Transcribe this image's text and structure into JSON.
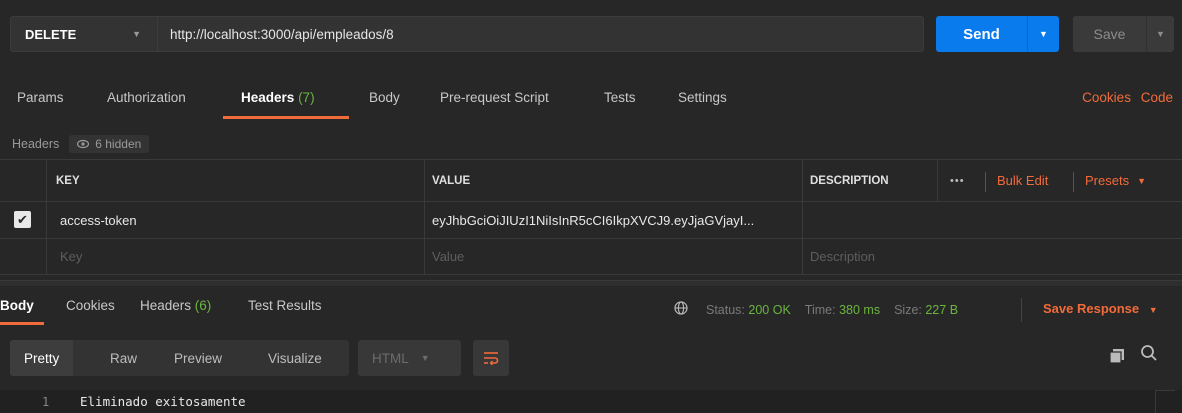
{
  "request": {
    "method": "DELETE",
    "url": "http://localhost:3000/api/empleados/8",
    "send_label": "Send",
    "save_label": "Save"
  },
  "request_tabs": {
    "params": "Params",
    "authorization": "Authorization",
    "headers": "Headers",
    "headers_count": "(7)",
    "body": "Body",
    "prerequest": "Pre-request Script",
    "tests": "Tests",
    "settings": "Settings",
    "cookies": "Cookies",
    "code": "Code"
  },
  "headers_section": {
    "label": "Headers",
    "hidden": "6 hidden"
  },
  "table": {
    "columns": {
      "key": "KEY",
      "value": "VALUE",
      "description": "DESCRIPTION"
    },
    "more": "•••",
    "bulk_edit": "Bulk Edit",
    "presets": "Presets",
    "rows": [
      {
        "key": "access-token",
        "value": "eyJhbGciOiJIUzI1NiIsInR5cCI6IkpXVCJ9.eyJjaGVjayI...",
        "checked": true
      }
    ],
    "placeholders": {
      "key": "Key",
      "value": "Value",
      "description": "Description"
    }
  },
  "response_tabs": {
    "body": "Body",
    "cookies": "Cookies",
    "headers": "Headers",
    "headers_count": "(6)",
    "test_results": "Test Results"
  },
  "status": {
    "status_label": "Status:",
    "status_value": "200 OK",
    "time_label": "Time:",
    "time_value": "380 ms",
    "size_label": "Size:",
    "size_value": "227 B",
    "save_response": "Save Response"
  },
  "format_toolbar": {
    "pretty": "Pretty",
    "raw": "Raw",
    "preview": "Preview",
    "visualize": "Visualize",
    "language": "HTML"
  },
  "response_body": {
    "line_number": "1",
    "text": "Eliminado exitosamente"
  },
  "colors": {
    "accent": "#f26b3a",
    "send": "#097bed",
    "success": "#6bb53f",
    "background": "#272727"
  }
}
